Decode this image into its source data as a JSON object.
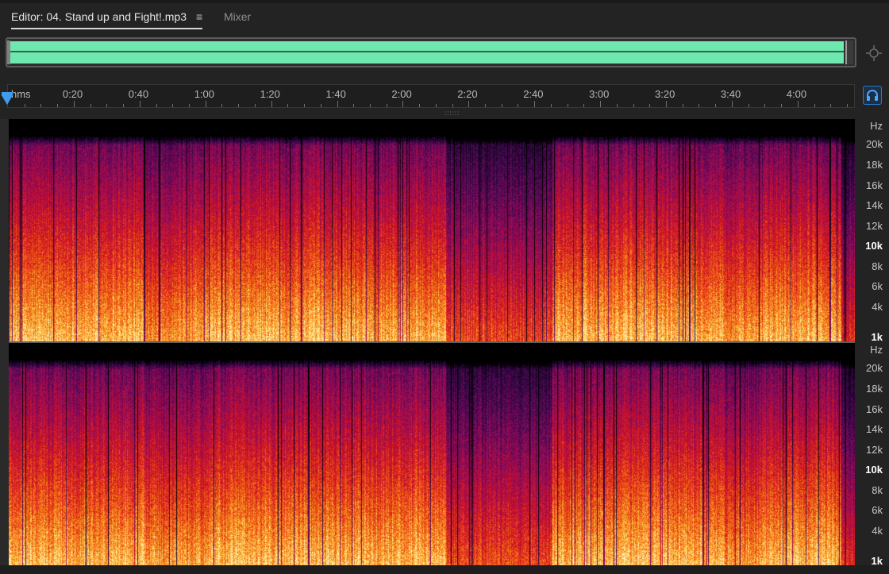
{
  "tabs": {
    "editor_label": "Editor: 04. Stand up and Fight!.mp3",
    "editor_menu_icon": "≡",
    "mixer_label": "Mixer"
  },
  "ruler": {
    "unit_label": "hms",
    "time_labels": [
      "0:20",
      "0:40",
      "1:00",
      "1:20",
      "1:40",
      "2:00",
      "2:20",
      "2:40",
      "3:00",
      "3:20",
      "3:40",
      "4:00"
    ]
  },
  "frequency_scale": {
    "unit": "Hz",
    "labels": [
      {
        "text": "20k",
        "bold": false
      },
      {
        "text": "18k",
        "bold": false
      },
      {
        "text": "16k",
        "bold": false
      },
      {
        "text": "14k",
        "bold": false
      },
      {
        "text": "12k",
        "bold": false
      },
      {
        "text": "10k",
        "bold": true
      },
      {
        "text": "8k",
        "bold": false
      },
      {
        "text": "6k",
        "bold": false
      },
      {
        "text": "4k",
        "bold": false
      },
      {
        "text": "1k",
        "bold": true
      }
    ]
  },
  "icons": {
    "zoom": "zoom-to-fit-icon",
    "monitor": "headphones-icon",
    "playhead": "playhead-icon",
    "menu": "hamburger-menu-icon"
  },
  "colors": {
    "overview_waveform": "#6fe8b0",
    "playhead": "#3e9cf0",
    "background": "#232323"
  }
}
